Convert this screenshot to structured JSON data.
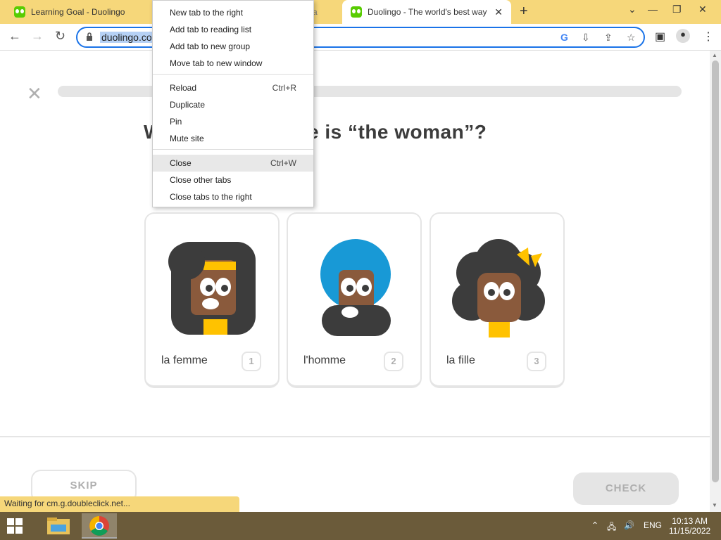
{
  "tabs": [
    {
      "title": "Learning Goal - Duolingo"
    },
    {
      "title": "ra"
    },
    {
      "title": "Duolingo - The world's best way"
    }
  ],
  "toolbar": {
    "url": "duolingo.co"
  },
  "lesson": {
    "question": "Which of these is “the woman”?",
    "question_visible": "W",
    "question_tail": "se is “the woman”?",
    "choices": [
      {
        "label": "la femme",
        "key": "1"
      },
      {
        "label": "l'homme",
        "key": "2"
      },
      {
        "label": "la fille",
        "key": "3"
      }
    ],
    "skip": "SKIP",
    "check": "CHECK"
  },
  "status_text": "Waiting for cm.g.doubleclick.net...",
  "context_menu": {
    "items": [
      {
        "label": "New tab to the right",
        "shortcut": ""
      },
      {
        "label": "Add tab to reading list",
        "shortcut": ""
      },
      {
        "label": "Add tab to new group",
        "shortcut": ""
      },
      {
        "label": "Move tab to new window",
        "shortcut": ""
      },
      {
        "label": "Reload",
        "shortcut": "Ctrl+R"
      },
      {
        "label": "Duplicate",
        "shortcut": ""
      },
      {
        "label": "Pin",
        "shortcut": ""
      },
      {
        "label": "Mute site",
        "shortcut": ""
      },
      {
        "label": "Close",
        "shortcut": "Ctrl+W"
      },
      {
        "label": "Close other tabs",
        "shortcut": ""
      },
      {
        "label": "Close tabs to the right",
        "shortcut": ""
      }
    ]
  },
  "taskbar": {
    "lang": "ENG",
    "time": "10:13 AM",
    "date": "11/15/2022"
  },
  "colors": {
    "tab_strip": "#f6d77a",
    "accent": "#1a73e8",
    "duolingo_green": "#58cc02",
    "taskbar": "#6b5b3a"
  }
}
